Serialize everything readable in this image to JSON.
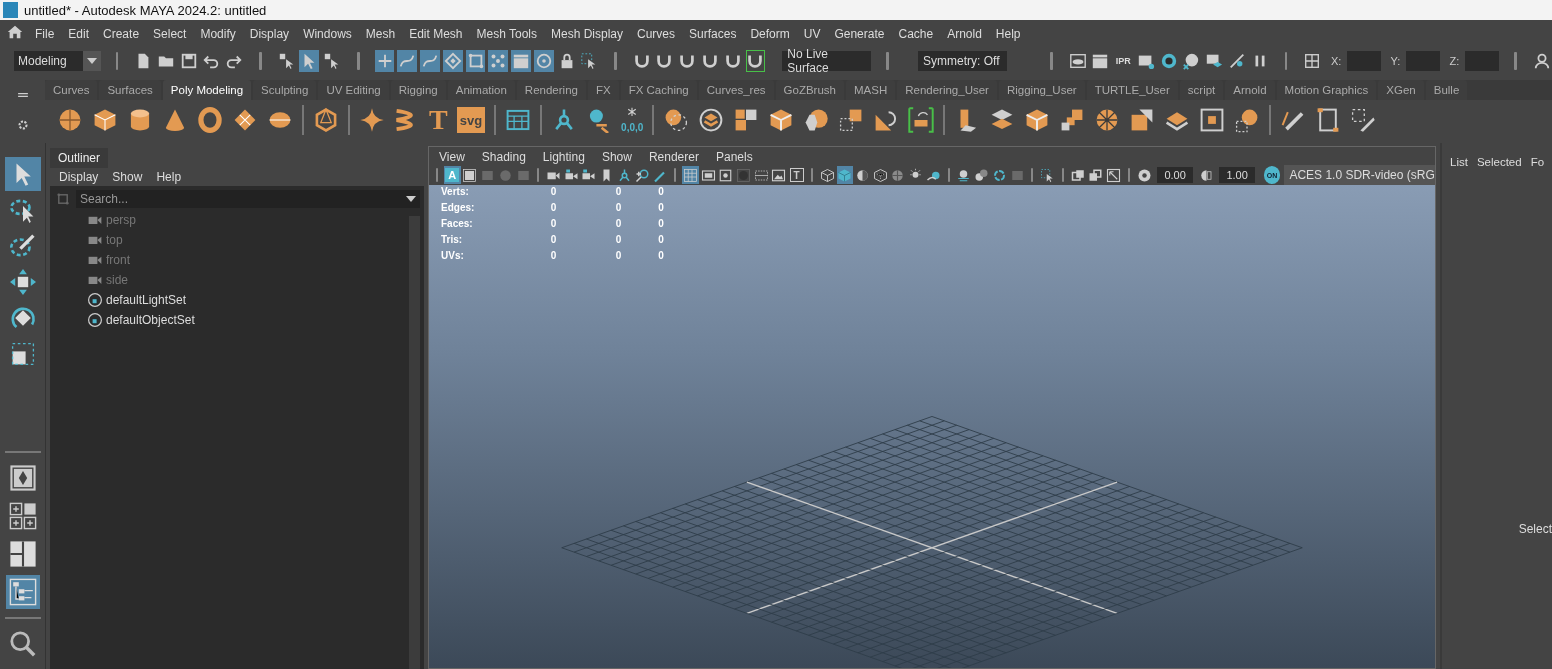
{
  "window": {
    "title": "untitled* - Autodesk MAYA 2024.2: untitled"
  },
  "menu_bar": [
    "File",
    "Edit",
    "Create",
    "Select",
    "Modify",
    "Display",
    "Windows",
    "Mesh",
    "Edit Mesh",
    "Mesh Tools",
    "Mesh Display",
    "Curves",
    "Surfaces",
    "Deform",
    "UV",
    "Generate",
    "Cache",
    "Arnold",
    "Help"
  ],
  "status_line": {
    "menu_set": "Modeling",
    "select_modes": [
      {
        "selected": false
      },
      {
        "selected": true
      },
      {
        "selected": false
      }
    ],
    "component_masks": [
      {
        "selected": true
      },
      {
        "selected": true
      },
      {
        "selected": true
      },
      {
        "selected": true
      },
      {
        "selected": true
      },
      {
        "selected": true
      },
      {
        "selected": true
      },
      {
        "selected": true
      }
    ],
    "snap_toggles": [
      {
        "selected": false
      },
      {
        "selected": false
      },
      {
        "selected": false
      },
      {
        "selected": false
      },
      {
        "selected": false
      },
      {
        "selected": true
      }
    ],
    "live_surface": "No Live Surface",
    "symmetry": "Symmetry: Off",
    "ipr_label": "IPR",
    "coordinates": [
      {
        "label": "X:"
      },
      {
        "label": "Y:"
      },
      {
        "label": "Z:"
      }
    ]
  },
  "shelf": {
    "tabs": [
      {
        "label": "Curves",
        "selected": false
      },
      {
        "label": "Surfaces",
        "selected": false
      },
      {
        "label": "Poly Modeling",
        "selected": true
      },
      {
        "label": "Sculpting",
        "selected": false
      },
      {
        "label": "UV Editing",
        "selected": false
      },
      {
        "label": "Rigging",
        "selected": false
      },
      {
        "label": "Animation",
        "selected": false
      },
      {
        "label": "Rendering",
        "selected": false
      },
      {
        "label": "FX",
        "selected": false
      },
      {
        "label": "FX Caching",
        "selected": false
      },
      {
        "label": "Curves_res",
        "selected": false
      },
      {
        "label": "GoZBrush",
        "selected": false
      },
      {
        "label": "MASH",
        "selected": false
      },
      {
        "label": "Rendering_User",
        "selected": false
      },
      {
        "label": "Rigging_User",
        "selected": false
      },
      {
        "label": "TURTLE_User",
        "selected": false
      },
      {
        "label": "script",
        "selected": false
      },
      {
        "label": "Arnold",
        "selected": false
      },
      {
        "label": "Motion Graphics",
        "selected": false
      },
      {
        "label": "XGen",
        "selected": false
      },
      {
        "label": "Bulle",
        "selected": false
      }
    ],
    "button_labels": [
      "T",
      "svg",
      "0,0,0"
    ]
  },
  "toolbox": {
    "tools": [
      {
        "selected": true
      },
      {
        "selected": false
      },
      {
        "selected": false
      },
      {
        "selected": false
      },
      {
        "selected": false
      },
      {
        "selected": false
      }
    ],
    "layouts": [
      {
        "selected": false
      },
      {
        "selected": false
      },
      {
        "selected": false
      },
      {
        "selected": true
      }
    ]
  },
  "outliner": {
    "title": "Outliner",
    "menu": [
      "Display",
      "Show",
      "Help"
    ],
    "search_placeholder": "Search...",
    "items": [
      {
        "label": "persp",
        "kind": "camera",
        "hidden": true
      },
      {
        "label": "top",
        "kind": "camera",
        "hidden": true
      },
      {
        "label": "front",
        "kind": "camera",
        "hidden": true
      },
      {
        "label": "side",
        "kind": "camera",
        "hidden": true
      },
      {
        "label": "defaultLightSet",
        "kind": "set",
        "hidden": false
      },
      {
        "label": "defaultObjectSet",
        "kind": "set",
        "hidden": false
      }
    ]
  },
  "viewport": {
    "menu": [
      "View",
      "Shading",
      "Lighting",
      "Show",
      "Renderer",
      "Panels"
    ],
    "toolbar_buttons": [
      {
        "selected": true,
        "label": "A"
      },
      {
        "selected": false
      },
      {
        "selected": false
      },
      {
        "selected": false
      },
      {
        "selected": false
      },
      {
        "selected": false
      },
      {
        "selected": false
      },
      {
        "selected": false
      },
      {
        "selected": false
      },
      {
        "selected": false
      },
      {
        "selected": false
      },
      {
        "selected": false
      },
      {
        "selected": true
      },
      {
        "selected": false
      },
      {
        "selected": false
      },
      {
        "selected": false
      },
      {
        "selected": false
      },
      {
        "selected": false
      },
      {
        "selected": false,
        "label": "T"
      },
      {
        "selected": false
      },
      {
        "selected": true
      },
      {
        "selected": false
      },
      {
        "selected": false
      },
      {
        "selected": false
      },
      {
        "selected": false
      },
      {
        "selected": false
      },
      {
        "selected": false
      },
      {
        "selected": false
      },
      {
        "selected": false
      },
      {
        "selected": false
      },
      {
        "selected": false
      },
      {
        "selected": false
      },
      {
        "selected": false
      },
      {
        "selected": false
      },
      {
        "selected": false
      }
    ],
    "exposure": "0.00",
    "gamma": "1.00",
    "color_management_badge": "ON",
    "color_space": "ACES 1.0 SDR-video (sRG",
    "hud": [
      {
        "label": "Verts:",
        "values": [
          "0",
          "0",
          "0"
        ]
      },
      {
        "label": "Edges:",
        "values": [
          "0",
          "0",
          "0"
        ]
      },
      {
        "label": "Faces:",
        "values": [
          "0",
          "0",
          "0"
        ]
      },
      {
        "label": "Tris:",
        "values": [
          "0",
          "0",
          "0"
        ]
      },
      {
        "label": "UVs:",
        "values": [
          "0",
          "0",
          "0"
        ]
      }
    ]
  },
  "side_panel": {
    "menu": [
      "List",
      "Selected",
      "Fo"
    ],
    "message": "Select"
  }
}
